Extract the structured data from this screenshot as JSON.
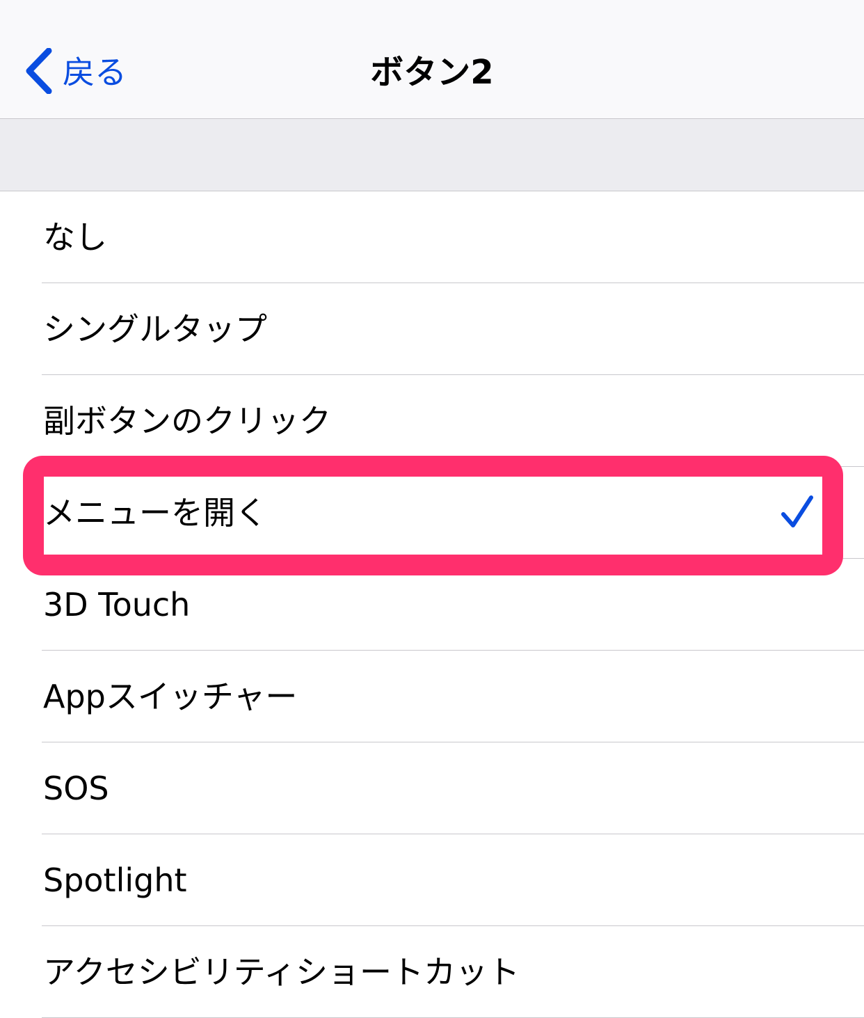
{
  "nav": {
    "back_label": "戻る",
    "title": "ボタン2"
  },
  "options": [
    {
      "label": "なし",
      "selected": false
    },
    {
      "label": "シングルタップ",
      "selected": false
    },
    {
      "label": "副ボタンのクリック",
      "selected": false
    },
    {
      "label": "メニューを開く",
      "selected": true
    },
    {
      "label": "3D Touch",
      "selected": false
    },
    {
      "label": "Appスイッチャー",
      "selected": false
    },
    {
      "label": "SOS",
      "selected": false
    },
    {
      "label": "Spotlight",
      "selected": false
    },
    {
      "label": "アクセシビリティショートカット",
      "selected": false
    }
  ],
  "colors": {
    "accent": "#0a4de0",
    "highlight": "#ff2f6d"
  }
}
